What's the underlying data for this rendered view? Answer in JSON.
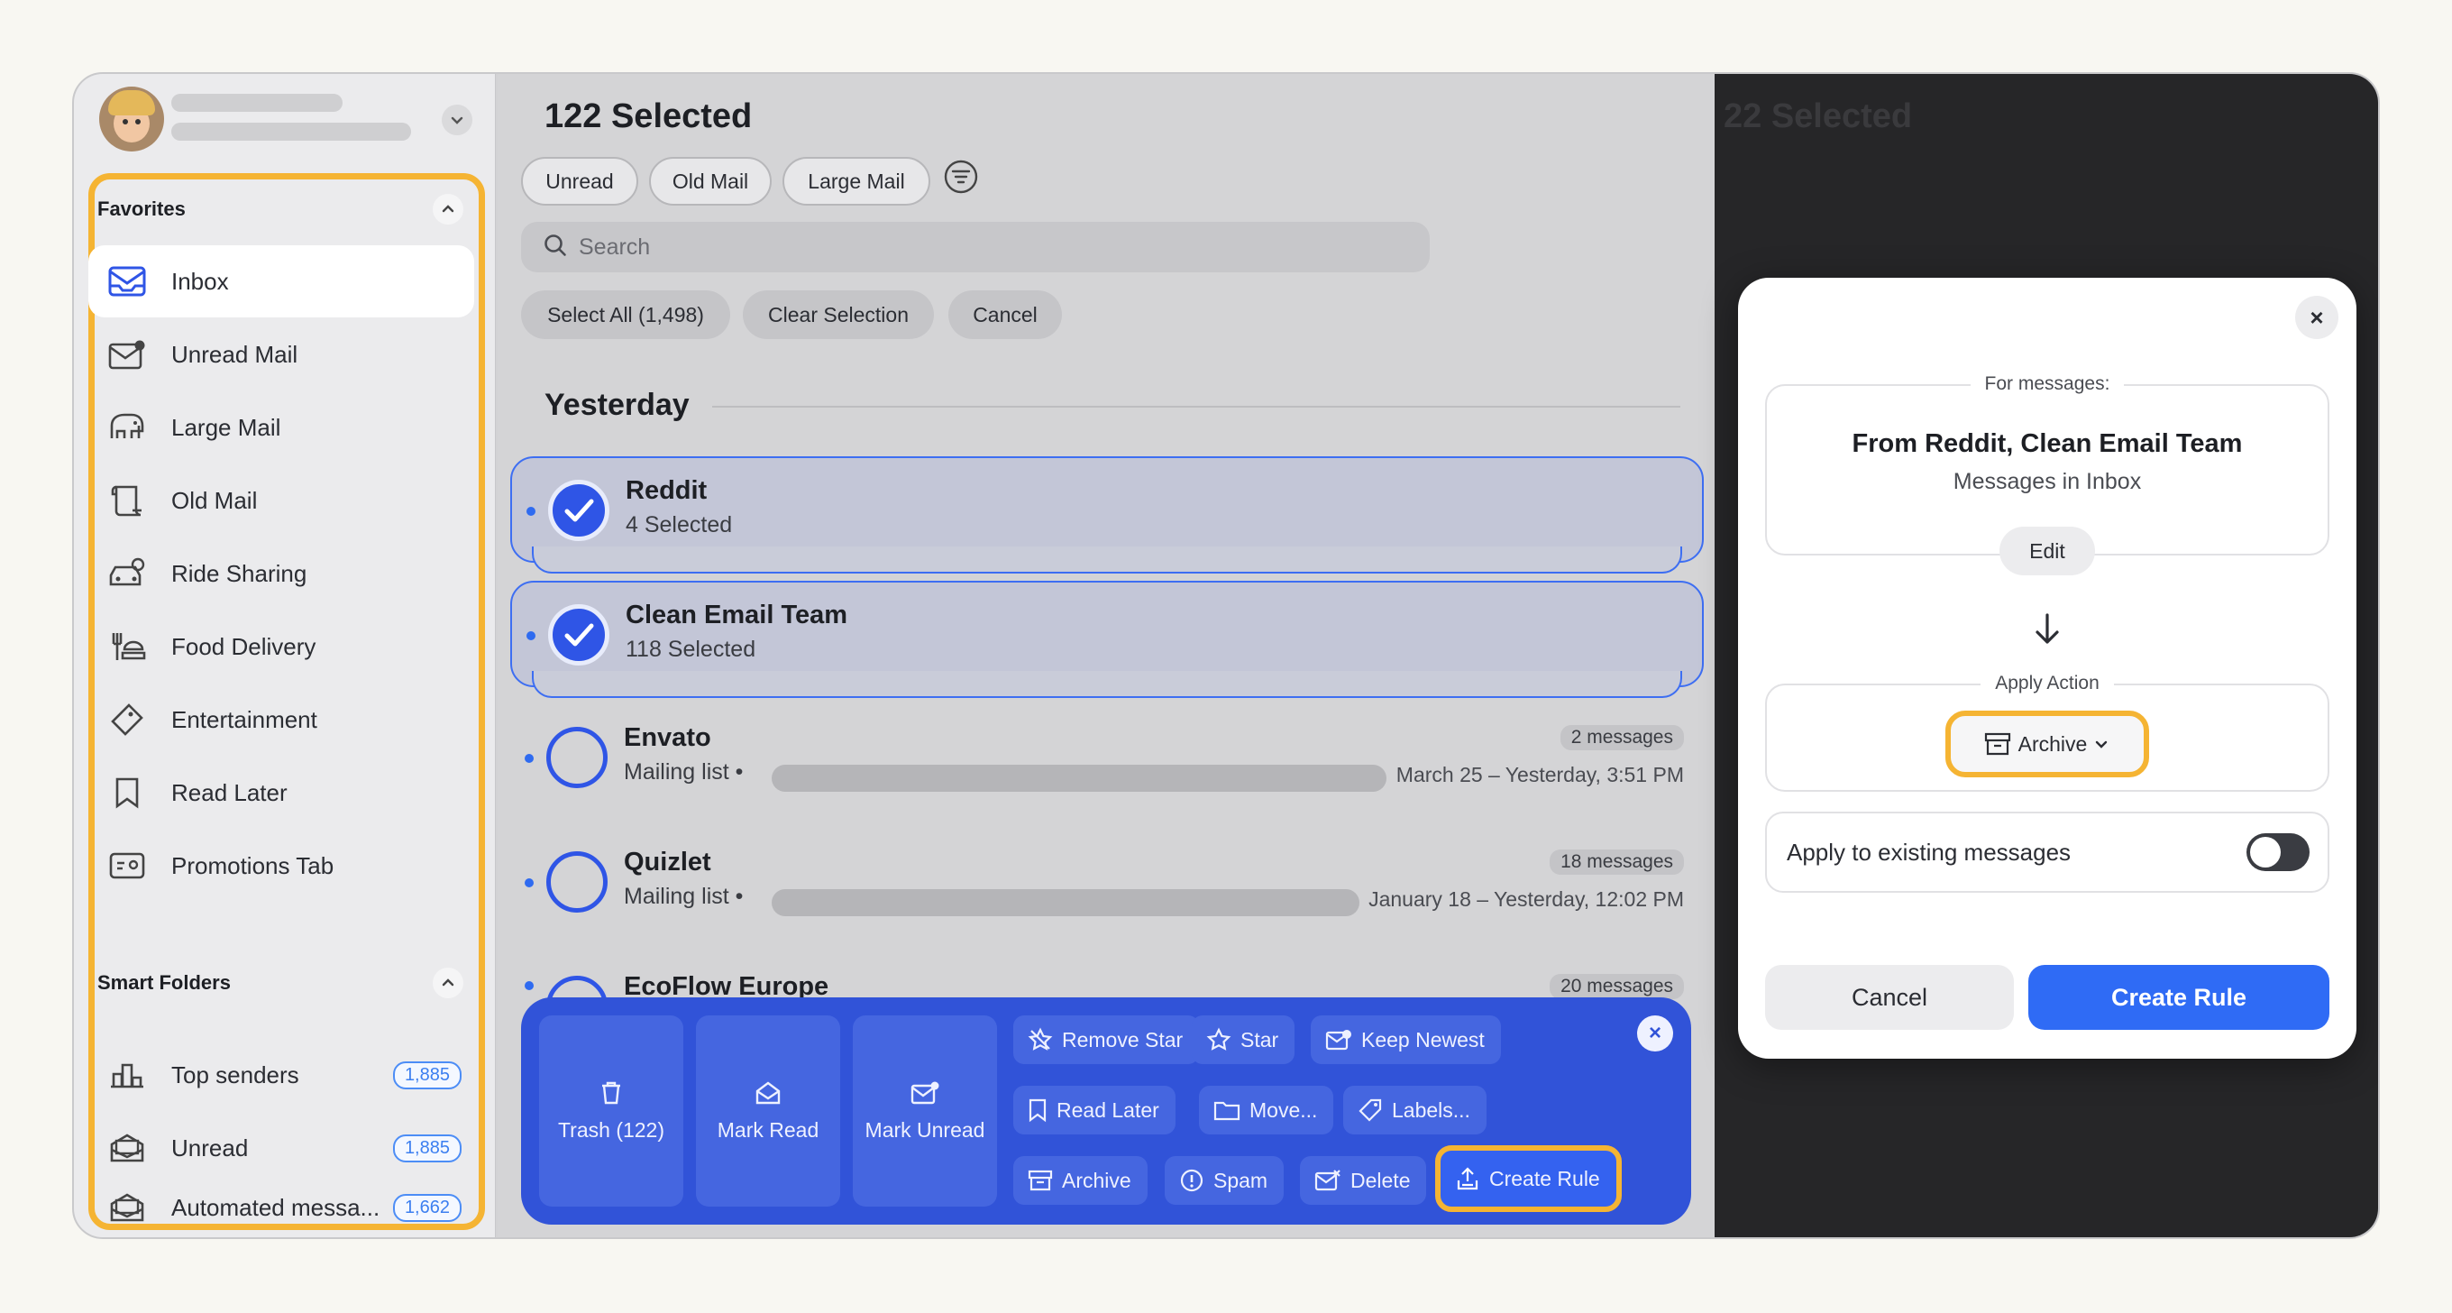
{
  "sidebar": {
    "favorites_title": "Favorites",
    "favorites": [
      {
        "label": "Inbox",
        "icon": "inbox-icon"
      },
      {
        "label": "Unread Mail",
        "icon": "unread-mail-icon"
      },
      {
        "label": "Large Mail",
        "icon": "elephant-icon"
      },
      {
        "label": "Old Mail",
        "icon": "scroll-icon"
      },
      {
        "label": "Ride Sharing",
        "icon": "car-icon"
      },
      {
        "label": "Food Delivery",
        "icon": "food-icon"
      },
      {
        "label": "Entertainment",
        "icon": "ticket-icon"
      },
      {
        "label": "Read Later",
        "icon": "bookmark-icon"
      },
      {
        "label": "Promotions Tab",
        "icon": "promotions-icon"
      }
    ],
    "smart_title": "Smart Folders",
    "smart": [
      {
        "label": "Top senders",
        "badge": "1,885",
        "icon": "top-senders-icon"
      },
      {
        "label": "Unread",
        "badge": "1,885",
        "icon": "unread-folder-icon"
      },
      {
        "label": "Automated messa...",
        "badge": "1,662",
        "icon": "automated-icon"
      }
    ]
  },
  "main": {
    "title": "122 Selected",
    "filters": [
      "Unread",
      "Old Mail",
      "Large Mail"
    ],
    "search_placeholder": "Search",
    "select_all": "Select All (1,498)",
    "clear_selection": "Clear Selection",
    "cancel": "Cancel",
    "day": "Yesterday",
    "rows": [
      {
        "name": "Reddit",
        "sub": "4 Selected",
        "selected": true
      },
      {
        "name": "Clean Email Team",
        "sub": "118 Selected",
        "selected": true
      },
      {
        "name": "Envato",
        "sub": "Mailing list •",
        "count": "2 messages",
        "date": "March 25 – Yesterday, 3:51 PM",
        "selected": false
      },
      {
        "name": "Quizlet",
        "sub": "Mailing list •",
        "count": "18 messages",
        "date": "January 18 – Yesterday, 12:02 PM",
        "selected": false
      },
      {
        "name": "EcoFlow Europe",
        "count": "20 messages",
        "selected": false
      }
    ]
  },
  "actions": {
    "trash": "Trash (122)",
    "mark_read": "Mark Read",
    "mark_unread": "Mark Unread",
    "remove_star": "Remove Star",
    "star": "Star",
    "keep_newest": "Keep Newest",
    "read_later": "Read Later",
    "move": "Move...",
    "labels": "Labels...",
    "archive": "Archive",
    "spam": "Spam",
    "delete": "Delete",
    "create_rule": "Create Rule"
  },
  "modal": {
    "for_messages": "For messages:",
    "from": "From Reddit, Clean Email Team",
    "scope": "Messages in Inbox",
    "edit": "Edit",
    "apply_action": "Apply Action",
    "action": "Archive",
    "apply_existing": "Apply to existing messages",
    "apply_existing_on": false,
    "cancel": "Cancel",
    "create": "Create Rule"
  },
  "background_ghost_title": "22 Selected",
  "colors": {
    "accent": "#2f6bf5",
    "highlight": "#f5b433",
    "action_bar": "#3153d8"
  }
}
